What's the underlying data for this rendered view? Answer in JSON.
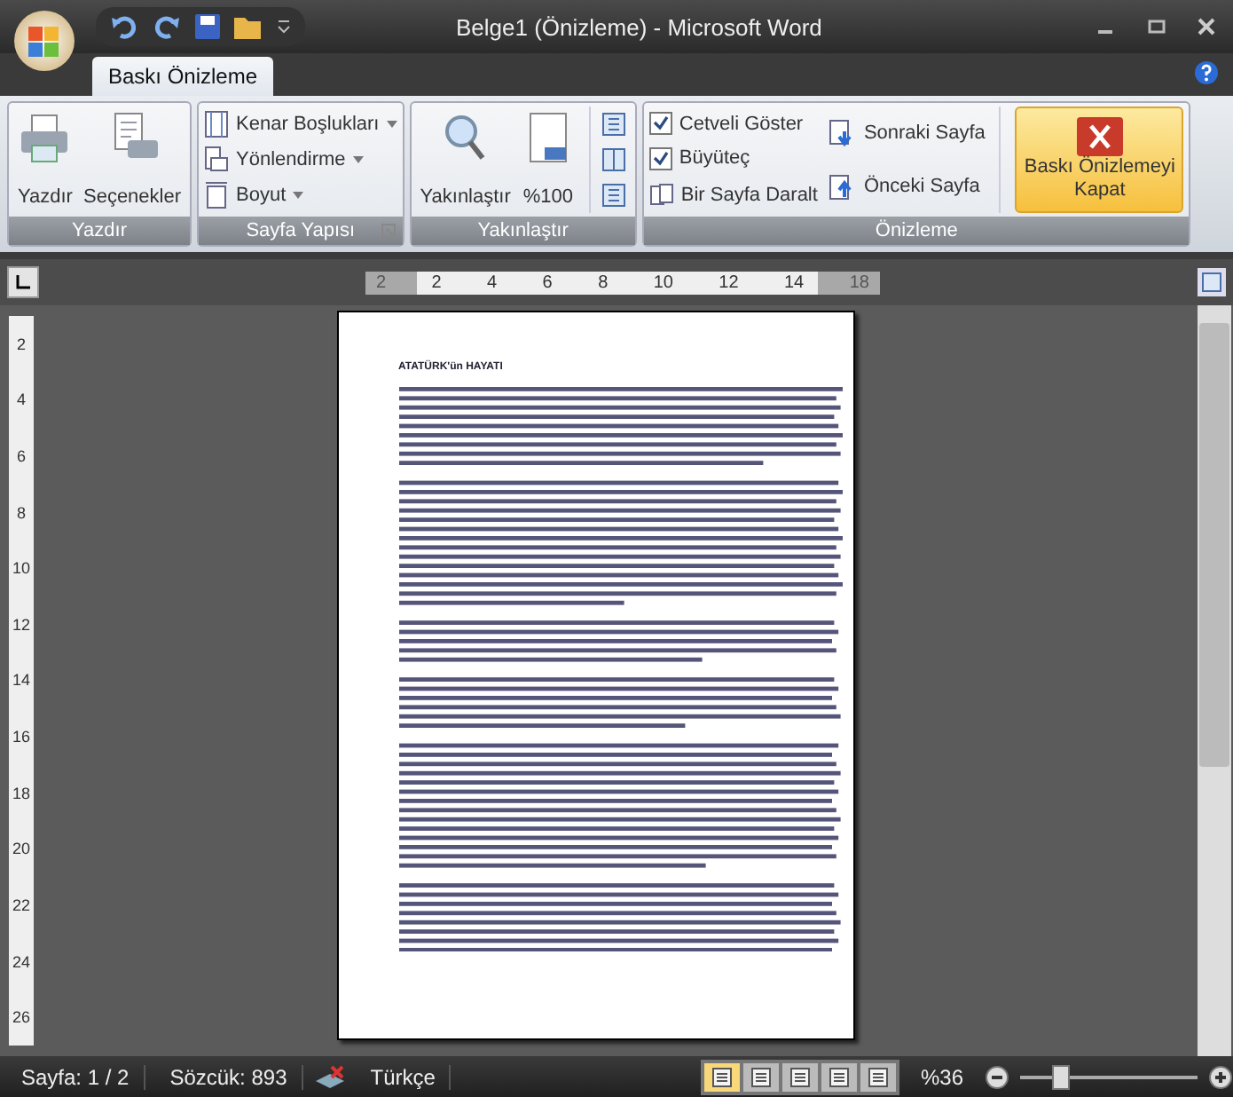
{
  "window": {
    "title": "Belge1 (Önizleme) - Microsoft Word"
  },
  "tabs": [
    {
      "label": "Baskı Önizleme",
      "selected": true
    }
  ],
  "print_group": {
    "title": "Yazdır",
    "buttons": [
      "Yazdır",
      "Seçenekler"
    ]
  },
  "page_setup_group": {
    "title": "Sayfa Yapısı",
    "buttons": [
      "Kenar Boşlukları",
      "Yönlendirme",
      "Boyut"
    ]
  },
  "zoom_group": {
    "title": "Yakınlaştır",
    "buttons": [
      "Yakınlaştır",
      "%100"
    ]
  },
  "preview_group": {
    "title": "Önizleme",
    "checkboxes": [
      {
        "label": "Cetveli Göster",
        "checked": true
      },
      {
        "label": "Büyüteç",
        "checked": true
      }
    ],
    "shrink_button": "Bir Sayfa Daralt",
    "next_button": "Sonraki Sayfa",
    "prev_button": "Önceki Sayfa",
    "close_button": [
      "Baskı Önizlemeyi",
      "Kapat"
    ]
  },
  "ruler": {
    "ticks": [
      "2",
      "2",
      "4",
      "6",
      "8",
      "10",
      "12",
      "14",
      "18"
    ]
  },
  "vertical_ruler": {
    "ticks": [
      "2",
      "4",
      "6",
      "8",
      "10",
      "12",
      "14",
      "16",
      "18",
      "20",
      "22",
      "24",
      "26"
    ]
  },
  "document": {
    "heading": "ATATÜRK'ün HAYATI"
  },
  "status_bar": {
    "page": "Sayfa: 1 / 2",
    "words": "Sözcük: 893",
    "language": "Türkçe",
    "views": [
      {
        "selected": true
      },
      {
        "selected": false
      },
      {
        "selected": false
      },
      {
        "selected": false
      },
      {
        "selected": false
      }
    ],
    "zoom": "%36",
    "zoom_slider": {
      "level": 0.22
    }
  }
}
